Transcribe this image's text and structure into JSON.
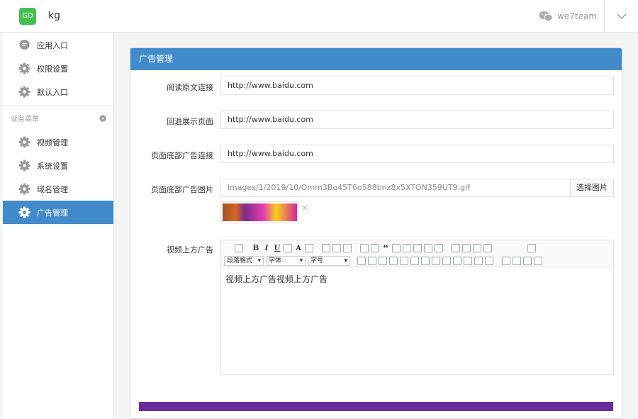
{
  "header": {
    "logo_text": "GD",
    "app_name": "kg",
    "username": "we7team",
    "user_icon": "wechat-icon",
    "menu_icon": "chevron-down-icon"
  },
  "sidebar": {
    "items_top": [
      {
        "label": "应用入口",
        "icon": "chat-bubble-icon"
      },
      {
        "label": "权限设置",
        "icon": "gear-icon"
      },
      {
        "label": "默认入口",
        "icon": "gear-icon"
      }
    ],
    "group_label": "业务菜单",
    "items_biz": [
      {
        "label": "视频管理",
        "icon": "gear-icon"
      },
      {
        "label": "系统设置",
        "icon": "gear-icon"
      },
      {
        "label": "域名管理",
        "icon": "gear-icon"
      },
      {
        "label": "广告管理",
        "icon": "gear-icon",
        "active": true
      }
    ]
  },
  "panel": {
    "title": "广告管理",
    "fields": {
      "read_more_label": "阅读原文连接",
      "read_more_value": "http://www.baidu.com",
      "fallback_label": "回退展示页面",
      "fallback_value": "http://www.baidu.com",
      "footer_ad_link_label": "页面底部广告连接",
      "footer_ad_link_value": "http://www.baidu.com",
      "footer_ad_image_label": "页面底部广告图片",
      "footer_ad_image_value": "images/1/2019/10/Omm3Bo45T6o588bnz8x5XTON359UT9.gif",
      "choose_image_button": "选择图片",
      "thumb_close": "×",
      "video_top_ad_label": "视频上方广告"
    },
    "editor": {
      "toolbar_text": {
        "bold": "B",
        "italic": "I",
        "underline": "U",
        "font_color": "A",
        "quote": "❛❛"
      },
      "selects": [
        {
          "label": "段落格式"
        },
        {
          "label": "字体"
        },
        {
          "label": "字号"
        }
      ],
      "content": "视频上方广告视频上方广告"
    }
  },
  "colors": {
    "primary": "#428bca",
    "logo_green": "#44c051",
    "bottom_bar": "#6a2c9a"
  }
}
